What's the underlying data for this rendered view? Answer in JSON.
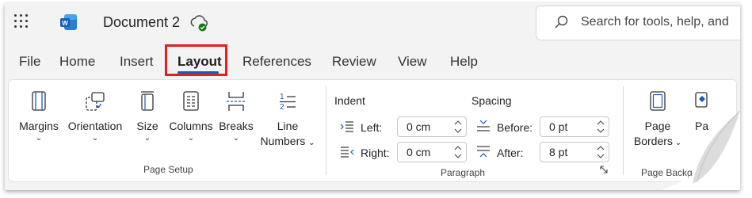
{
  "titlebar": {
    "doc_title": "Document 2",
    "search_placeholder": "Search for tools, help, and"
  },
  "tabs": [
    {
      "label": "File"
    },
    {
      "label": "Home"
    },
    {
      "label": "Insert"
    },
    {
      "label": "Layout",
      "active": true
    },
    {
      "label": "References"
    },
    {
      "label": "Review"
    },
    {
      "label": "View"
    },
    {
      "label": "Help"
    }
  ],
  "page_setup": {
    "group_label": "Page Setup",
    "margins": "Margins",
    "orientation": "Orientation",
    "size": "Size",
    "columns": "Columns",
    "breaks": "Breaks",
    "line_numbers_1": "Line",
    "line_numbers_2": "Numbers"
  },
  "paragraph": {
    "group_label": "Paragraph",
    "indent_header": "Indent",
    "spacing_header": "Spacing",
    "left_label": "Left:",
    "left_value": "0 cm",
    "right_label": "Right:",
    "right_value": "0 cm",
    "before_label": "Before:",
    "before_value": "0 pt",
    "after_label": "After:",
    "after_value": "8 pt"
  },
  "page_background": {
    "group_label": "Page Backg",
    "page_borders_1": "Page",
    "page_borders_2": "Borders",
    "page_color_partial": "Pa"
  },
  "colors": {
    "accent": "#185abd",
    "highlight_box": "#e02020"
  }
}
